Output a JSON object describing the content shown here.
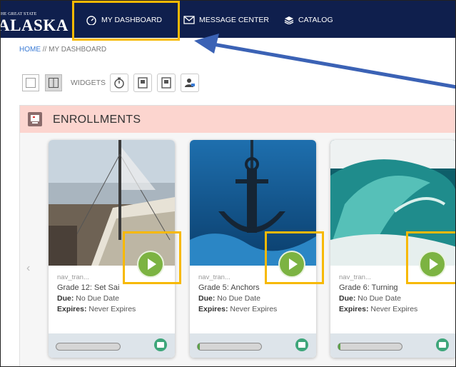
{
  "logo": {
    "small": "HE GREAT STATE",
    "big": "ALASKA"
  },
  "nav": [
    {
      "label": "MY DASHBOARD",
      "icon": "dashboard-gauge-icon"
    },
    {
      "label": "MESSAGE CENTER",
      "icon": "envelope-icon"
    },
    {
      "label": "CATALOG",
      "icon": "book-stack-icon"
    }
  ],
  "breadcrumb": {
    "home": "HOME",
    "separator": " // ",
    "current": "MY DASHBOARD"
  },
  "toolbar": {
    "widgets_label": "WIDGETS"
  },
  "panel": {
    "title": "ENROLLMENTS"
  },
  "cards": [
    {
      "subtitle": "nav_tran...",
      "title": "Grade 12: Set Sai",
      "due_label": "Due:",
      "due_value": " No Due Date",
      "expires_label": "Expires:",
      "expires_value": " Never Expires",
      "progress": 0.0
    },
    {
      "subtitle": "nav_tran...",
      "title": "Grade 5: Anchors",
      "due_label": "Due:",
      "due_value": " No Due Date",
      "expires_label": "Expires:",
      "expires_value": " Never Expires",
      "progress": 0.03
    },
    {
      "subtitle": "nav_tran...",
      "title": "Grade 6: Turning",
      "due_label": "Due:",
      "due_value": " No Due Date",
      "expires_label": "Expires:",
      "expires_value": " Never Expires",
      "progress": 0.03
    }
  ],
  "colors": {
    "nav_bg": "#0f1f4d",
    "highlight": "#f7b900",
    "arrow": "#3b62b5",
    "panel_header": "#fcd5cf",
    "play": "#7cb342"
  }
}
